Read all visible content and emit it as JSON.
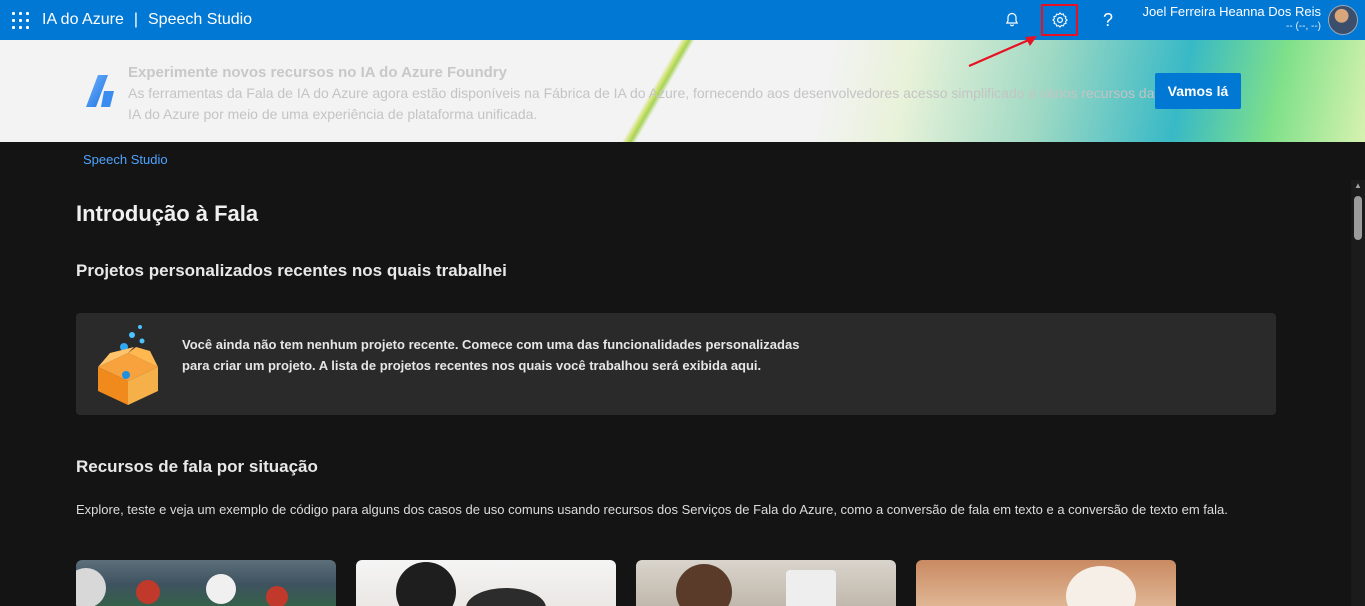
{
  "topbar": {
    "app_name": "IA do Azure",
    "separator": "|",
    "product": "Speech Studio",
    "icons": [
      "waffle-icon",
      "bell-icon",
      "gear-icon",
      "help-icon"
    ],
    "help_glyph": "?",
    "user_name": "Joel Ferreira Heanna Dos Reis",
    "user_sub": "-- (--, --)"
  },
  "banner": {
    "title": "Experimente novos recursos no IA do Azure Foundry",
    "text": "As ferramentas da Fala de IA do Azure agora estão disponíveis na Fábrica de IA do Azure, fornecendo aos desenvolvedores acesso simplificado a vários recursos da IA do Azure por meio de uma experiência de plataforma unificada.",
    "button": "Vamos lá"
  },
  "breadcrumb": "Speech Studio",
  "page_title": "Introdução à Fala",
  "recent": {
    "heading": "Projetos personalizados recentes nos quais trabalhei",
    "empty_message": "Você ainda não tem nenhum projeto recente. Comece com uma das funcionalidades personalizadas para criar um projeto. A lista de projetos recentes nos quais você trabalhou será exibida aqui."
  },
  "scenarios": {
    "heading": "Recursos de fala por situação",
    "description": "Explore, teste e veja um exemplo de código para alguns dos casos de uso comuns usando recursos dos Serviços de Fala do Azure, como a conversão de fala em texto e a conversão de texto em fala."
  },
  "colors": {
    "accent": "#0078d4",
    "highlight": "#e81123",
    "link": "#4fa3ff",
    "background": "#141414",
    "card": "#2a2a2a"
  }
}
